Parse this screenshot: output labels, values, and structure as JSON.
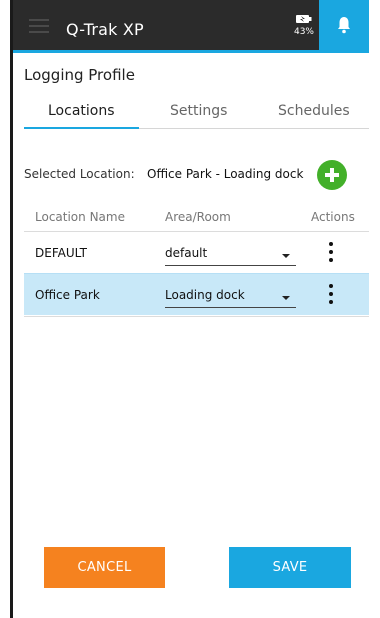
{
  "app": {
    "title": "Q-Trak XP",
    "battery_percent": "43%"
  },
  "page": {
    "title": "Logging Profile"
  },
  "tabs": [
    {
      "label": "Locations",
      "active": true
    },
    {
      "label": "Settings",
      "active": false
    },
    {
      "label": "Schedules",
      "active": false
    }
  ],
  "selected_location": {
    "label": "Selected Location:",
    "value": "Office Park - Loading dock"
  },
  "table": {
    "headers": [
      "Location Name",
      "Area/Room",
      "Actions"
    ],
    "rows": [
      {
        "name": "DEFAULT",
        "area": "default",
        "selected": false
      },
      {
        "name": "Office Park",
        "area": "Loading dock",
        "selected": true
      }
    ]
  },
  "buttons": {
    "cancel": "CANCEL",
    "save": "SAVE"
  },
  "icons": {
    "menu": "hamburger-icon",
    "battery": "battery-icon",
    "notifications": "bell-icon",
    "add": "plus-circle-icon",
    "row_actions": "kebab-menu-icon",
    "dropdown": "caret-down-icon"
  },
  "colors": {
    "header_bg": "#2b2b2b",
    "accent": "#1aa7e0",
    "add_green": "#43b02a",
    "cancel_orange": "#f5821f",
    "selected_row": "#c8e8f8"
  }
}
